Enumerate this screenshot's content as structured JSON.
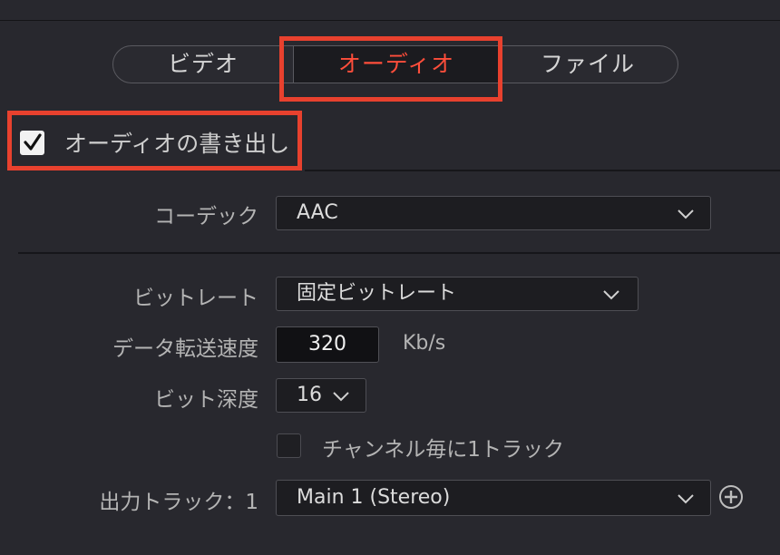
{
  "tabs": [
    {
      "label": "ビデオ",
      "active": false
    },
    {
      "label": "オーディオ",
      "active": true
    },
    {
      "label": "ファイル",
      "active": false
    }
  ],
  "export_audio": {
    "label": "オーディオの書き出し",
    "checked": true
  },
  "codec": {
    "label": "コーデック",
    "value": "AAC"
  },
  "bitrate": {
    "label": "ビットレート",
    "value": "固定ビットレート"
  },
  "data_rate": {
    "label": "データ転送速度",
    "value": "320",
    "unit": "Kb/s"
  },
  "bit_depth": {
    "label": "ビット深度",
    "value": "16"
  },
  "one_track_per_channel": {
    "label": "チャンネル毎に1トラック",
    "checked": false
  },
  "output_track": {
    "label": "出力トラック：1",
    "value": "Main 1 (Stereo)"
  },
  "colors": {
    "active_tab": "#ff4e3b",
    "highlight_box": "#e8412e",
    "background": "#28282e"
  }
}
